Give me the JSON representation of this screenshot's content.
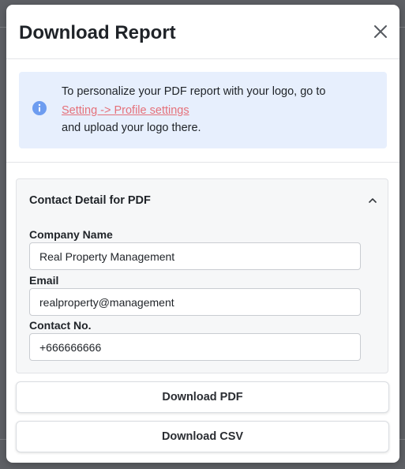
{
  "modal": {
    "title": "Download Report",
    "close_icon": "close-icon"
  },
  "info": {
    "icon": "info-icon",
    "line1": "To personalize your PDF report with your logo, go to",
    "link": "Setting -> Profile settings",
    "line3": "and upload your logo there.",
    "bg_color": "#e7effd",
    "link_color": "#e5717a",
    "icon_color": "#6d9cf0"
  },
  "contact": {
    "title": "Contact Detail for PDF",
    "chevron_icon": "chevron-up-icon",
    "fields": [
      {
        "label": "Company Name",
        "value": "Real Property Management"
      },
      {
        "label": "Email",
        "value": "realproperty@management"
      },
      {
        "label": "Contact No.",
        "value": "+666666666"
      }
    ]
  },
  "buttons": {
    "download_pdf": "Download PDF",
    "download_csv": "Download CSV"
  }
}
